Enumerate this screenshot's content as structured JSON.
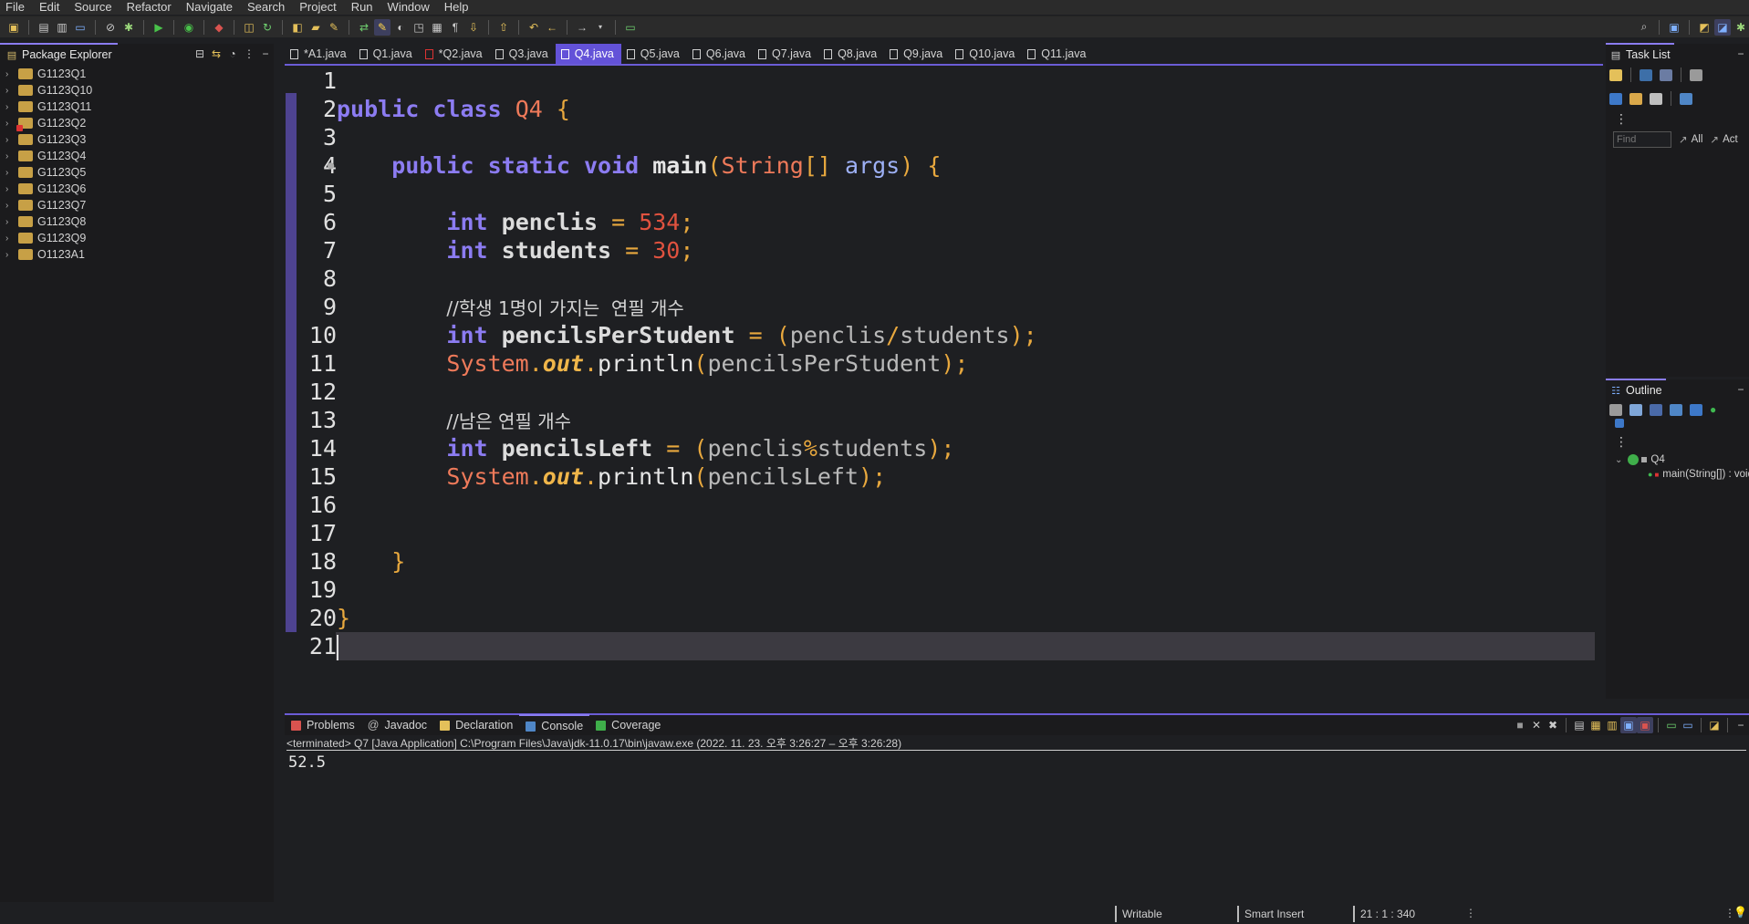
{
  "menu": [
    "File",
    "Edit",
    "Source",
    "Refactor",
    "Navigate",
    "Search",
    "Project",
    "Run",
    "Window",
    "Help"
  ],
  "package_explorer": {
    "title": "Package Explorer",
    "projects": [
      "G1123Q1",
      "G1123Q10",
      "G1123Q11",
      "G1123Q2",
      "G1123Q3",
      "G1123Q4",
      "G1123Q5",
      "G1123Q6",
      "G1123Q7",
      "G1123Q8",
      "G1123Q9",
      "O1123A1"
    ]
  },
  "editor_tabs": [
    "*A1.java",
    "Q1.java",
    "*Q2.java",
    "Q3.java",
    "Q4.java",
    "Q5.java",
    "Q6.java",
    "Q7.java",
    "Q8.java",
    "Q9.java",
    "Q10.java",
    "Q11.java"
  ],
  "active_tab": "Q4.java",
  "code": {
    "line_numbers": [
      "1",
      "2",
      "3",
      "4",
      "5",
      "6",
      "7",
      "8",
      "9",
      "10",
      "11",
      "12",
      "13",
      "14",
      "15",
      "16",
      "17",
      "18",
      "19",
      "20",
      "21"
    ],
    "l2": {
      "kw1": "public",
      "kw2": "class",
      "cls": "Q4",
      "br": "{"
    },
    "l4": {
      "kw1": "public",
      "kw2": "static",
      "kw3": "void",
      "fn": "main",
      "p1": "(",
      "cls": "String",
      "arr": "[]",
      "arg": "args",
      "p2": ")",
      "br": "{"
    },
    "l6": {
      "kw": "int",
      "var": "penclis",
      "eq": "=",
      "num": "534",
      "semi": ";"
    },
    "l7": {
      "kw": "int",
      "var": "students",
      "eq": "=",
      "num": "30",
      "semi": ";"
    },
    "l9": {
      "comment": "//학생 1명이 가지는  연필 개수"
    },
    "l10": {
      "kw": "int",
      "var": "pencilsPerStudent",
      "eq": "=",
      "p1": "(",
      "a": "penclis",
      "op": "/",
      "b": "students",
      "p2": ")",
      "semi": ";"
    },
    "l11": {
      "cls": "System",
      "dot1": ".",
      "out": "out",
      "dot2": ".",
      "fn": "println",
      "p1": "(",
      "arg": "pencilsPerStudent",
      "p2": ")",
      "semi": ";"
    },
    "l13": {
      "comment": "//남은 연필 개수"
    },
    "l14": {
      "kw": "int",
      "var": "pencilsLeft",
      "eq": "=",
      "p1": "(",
      "a": "penclis",
      "op": "%",
      "b": "students",
      "p2": ")",
      "semi": ";"
    },
    "l15": {
      "cls": "System",
      "dot1": ".",
      "out": "out",
      "dot2": ".",
      "fn": "println",
      "p1": "(",
      "arg": "pencilsLeft",
      "p2": ")",
      "semi": ";"
    },
    "l18": {
      "br": "}"
    },
    "l20": {
      "br": "}"
    }
  },
  "task_list": {
    "title": "Task List",
    "find_placeholder": "Find",
    "all": "All",
    "activate": "Act"
  },
  "outline": {
    "title": "Outline",
    "class_name": "Q4",
    "method": "main(String[]) : void"
  },
  "console": {
    "tabs": [
      "Problems",
      "Javadoc",
      "Declaration",
      "Console",
      "Coverage"
    ],
    "active_tab": "Console",
    "header": "<terminated> Q7 [Java Application] C:\\Program Files\\Java\\jdk-11.0.17\\bin\\javaw.exe  (2022. 11. 23. 오후 3:26:27 – 오후 3:26:28)",
    "output": "52.5"
  },
  "status": {
    "writable": "Writable",
    "insert_mode": "Smart Insert",
    "position": "21 : 1 : 340"
  },
  "colors": {
    "accent": "#6352d8",
    "background": "#1e1f22",
    "keyword": "#8c7cf2",
    "number": "#e0523f",
    "brace": "#e8a83e"
  }
}
